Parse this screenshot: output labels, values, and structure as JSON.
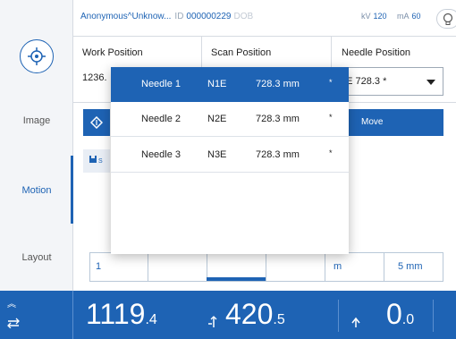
{
  "header": {
    "patient_name": "Anonymous^Unknow...",
    "id_label": "ID",
    "id_value": "000000229",
    "dob": "DOB",
    "kv_label": "kV",
    "kv_value": "120",
    "ma_label": "mA",
    "ma_value": "60"
  },
  "sidebar": {
    "items": [
      {
        "label": "Image"
      },
      {
        "label": "Motion"
      },
      {
        "label": "Layout"
      }
    ],
    "active": "Motion"
  },
  "main": {
    "work_position_label": "Work Position",
    "work_position_value": "1236.",
    "scan_position_label": "Scan Position",
    "needle_position_label": "Needle Position",
    "needle_select_value": "1E 728.3 *",
    "move_label": "Move",
    "save_partial_label": "S"
  },
  "segments": [
    {
      "label": "1"
    },
    {
      "label": ""
    },
    {
      "label": ""
    },
    {
      "label": ""
    },
    {
      "label": "m"
    },
    {
      "label": "5 mm"
    }
  ],
  "dropdown": {
    "options": [
      {
        "name": "Needle 1",
        "code": "N1E",
        "length": "728.3 mm",
        "mark": "*",
        "selected": true
      },
      {
        "name": "Needle 2",
        "code": "N2E",
        "length": "728.3 mm",
        "mark": "*",
        "selected": false
      },
      {
        "name": "Needle 3",
        "code": "N3E",
        "length": "728.3 mm",
        "mark": "*",
        "selected": false
      }
    ]
  },
  "status": {
    "pos1_int": "1119",
    "pos1_dec": ".4",
    "pos2_int": "420",
    "pos2_dec": ".5",
    "pos3_int": "0",
    "pos3_dec": ".0"
  },
  "colors": {
    "accent": "#1e63b4",
    "sidebar_bg": "#f3f5f8",
    "border": "#d6dbe2"
  },
  "icons": [
    "bulb-icon",
    "gantry-logo-icon",
    "diamond-icon",
    "save-icon",
    "chevron-up-icon",
    "table-horizontal-icon",
    "table-vertical-icon",
    "tilt-icon"
  ]
}
